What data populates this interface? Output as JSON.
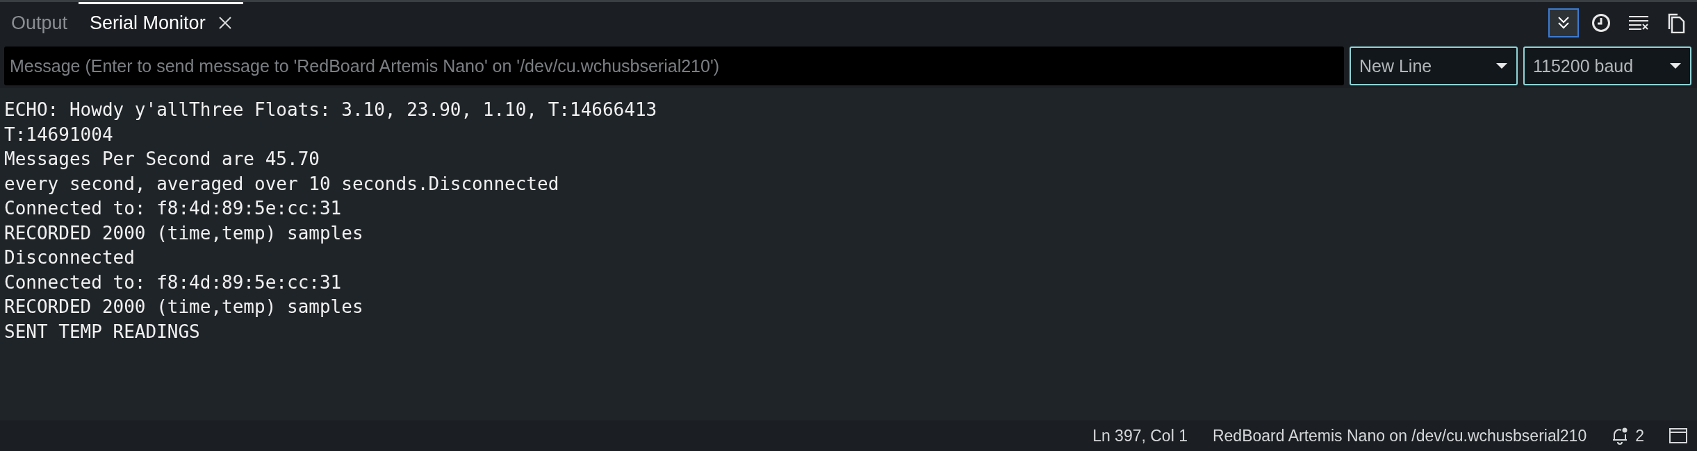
{
  "tabs": [
    {
      "label": "Output",
      "selected": false,
      "closable": false
    },
    {
      "label": "Serial Monitor",
      "selected": true,
      "closable": true
    }
  ],
  "toolbar": [
    {
      "kind": "autoscroll",
      "on": true
    },
    {
      "kind": "timestamp",
      "on": false
    },
    {
      "kind": "clear",
      "on": false
    },
    {
      "kind": "copy",
      "on": false
    }
  ],
  "message": {
    "placeholder": "Message (Enter to send message to 'RedBoard Artemis Nano' on '/dev/cu.wchusbserial210')"
  },
  "line_ending": {
    "value": "New Line"
  },
  "baud_rate": {
    "value": "115200 baud"
  },
  "output": [
    "ECHO: Howdy y'allThree Floats: 3.10, 23.90, 1.10, T:14666413",
    "T:14691004",
    "Messages Per Second are 45.70",
    "every second, averaged over 10 seconds.Disconnected",
    "Connected to: f8:4d:89:5e:cc:31",
    "RECORDED 2000 (time,temp) samples",
    "Disconnected",
    "Connected to: f8:4d:89:5e:cc:31",
    "RECORDED 2000 (time,temp) samples",
    "SENT TEMP READINGS"
  ],
  "status_bar": {
    "position": "Ln 397, Col 1",
    "board": "RedBoard Artemis Nano on /dev/cu.wchusbserial210",
    "notifications": "2"
  }
}
